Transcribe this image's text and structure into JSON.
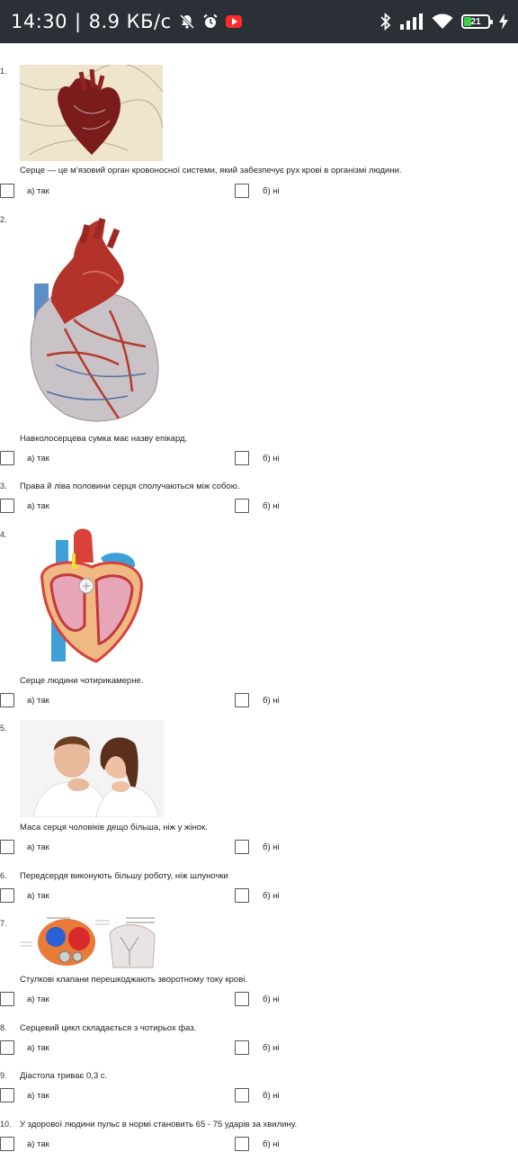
{
  "status_bar": {
    "time": "14:30",
    "separator": "|",
    "speed": "8.9 КБ/с",
    "battery": "21",
    "icons": [
      "mute-bell-icon",
      "alarm-icon",
      "youtube-icon",
      "bluetooth-icon",
      "signal-icon",
      "wifi-icon",
      "battery-icon",
      "charging-icon"
    ]
  },
  "colors": {
    "status_bar_bg": "#2b2f36",
    "battery_fill": "#3fcf4a",
    "youtube": "#ff2d2d"
  },
  "questions": [
    {
      "number": "1.",
      "text": "Серце — це м’язовий орган кровоносної системи, який забезпечує рух крові в організмі людини.",
      "image": "heart-illustration-image",
      "option_a": "а)  так",
      "option_b": "б)  ні"
    },
    {
      "number": "2.",
      "text": "Навколосерцева сумка має назву епікард.",
      "image": "anatomical-heart-image",
      "option_a": "а)  так",
      "option_b": "б)  ні"
    },
    {
      "number": "3.",
      "text": "Права й ліва половини серця сполучаються між собою.",
      "image": "",
      "option_a": "а)  так",
      "option_b": "б)  ні"
    },
    {
      "number": "4.",
      "text": "Серце людини чотирикамерне.",
      "image": "heart-chambers-diagram-image",
      "option_a": "а)  так",
      "option_b": "б)  ні"
    },
    {
      "number": "5.",
      "text": "Маса серця чоловіків дещо більша, ніж у жінок.",
      "image": "man-and-woman-photo",
      "option_a": "а)  так",
      "option_b": "б)  ні"
    },
    {
      "number": "6.",
      "text": "Передсердя виконують більшу роботу, ніж шлуночки",
      "image": "",
      "option_a": "а)  так",
      "option_b": "б)  ні"
    },
    {
      "number": "7.",
      "text": "Стулкові клапани перешкоджають зворотному току крові.",
      "image": "heart-valves-diagram-image",
      "option_a": "а)  так",
      "option_b": "б)  ні"
    },
    {
      "number": "8.",
      "text": "Серцевий цикл складається з чотирьох фаз.",
      "image": "",
      "option_a": "а)  так",
      "option_b": "б)  ні"
    },
    {
      "number": "9.",
      "text": "Діастола триває 0,3 с.",
      "image": "",
      "option_a": "а)  так",
      "option_b": "б)  ні"
    },
    {
      "number": "10.",
      "text": "У здорової людини пульс в нормі становить 65 - 75 ударів за хвилину.",
      "image": "",
      "option_a": "а)  так",
      "option_b": "б)  ні"
    }
  ]
}
